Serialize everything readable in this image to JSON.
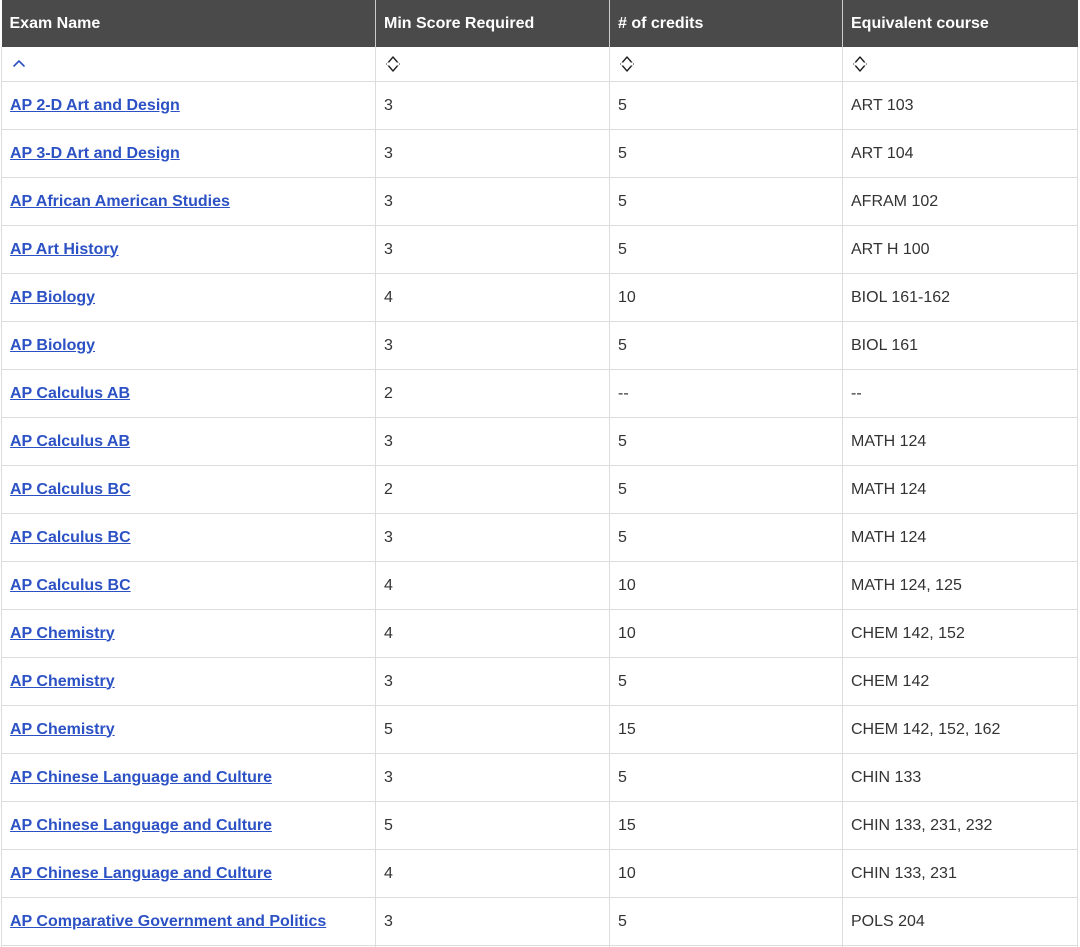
{
  "table": {
    "columns": [
      "Exam Name",
      "Min Score Required",
      "# of credits",
      "Equivalent course"
    ],
    "sort_icons": [
      "sort-ascending-icon",
      "sort-unsorted-icon",
      "sort-unsorted-icon",
      "sort-unsorted-icon"
    ],
    "rows": [
      [
        "AP 2-D Art and Design",
        "3",
        "5",
        "ART 103"
      ],
      [
        "AP 3-D Art and Design",
        "3",
        "5",
        "ART 104"
      ],
      [
        "AP African American Studies",
        "3",
        "5",
        "AFRAM 102"
      ],
      [
        "AP Art History",
        "3",
        "5",
        "ART H 100"
      ],
      [
        "AP Biology",
        "4",
        "10",
        "BIOL 161-162"
      ],
      [
        "AP Biology",
        "3",
        "5",
        "BIOL 161"
      ],
      [
        "AP Calculus AB",
        "2",
        "--",
        "--"
      ],
      [
        "AP Calculus AB",
        "3",
        "5",
        "MATH 124"
      ],
      [
        "AP Calculus BC",
        "2",
        "5",
        "MATH 124"
      ],
      [
        "AP Calculus BC",
        "3",
        "5",
        "MATH 124"
      ],
      [
        "AP Calculus BC",
        "4",
        "10",
        "MATH 124, 125"
      ],
      [
        "AP Chemistry",
        "4",
        "10",
        "CHEM 142, 152"
      ],
      [
        "AP Chemistry",
        "3",
        "5",
        "CHEM 142"
      ],
      [
        "AP Chemistry",
        "5",
        "15",
        "CHEM 142, 152, 162"
      ],
      [
        "AP Chinese Language and Culture",
        "3",
        "5",
        "CHIN 133"
      ],
      [
        "AP Chinese Language and Culture",
        "5",
        "15",
        "CHIN 133, 231, 232"
      ],
      [
        "AP Chinese Language and Culture",
        "4",
        "10",
        "CHIN 133, 231"
      ],
      [
        "AP Comparative Government and Politics",
        "3",
        "5",
        "POLS 204"
      ],
      [
        "",
        "",
        "",
        ""
      ]
    ]
  },
  "colors": {
    "header_bg": "#4a4a4a",
    "link": "#2b51c4",
    "sort_icon": "#2b51c4",
    "border": "#dcdcdc"
  }
}
